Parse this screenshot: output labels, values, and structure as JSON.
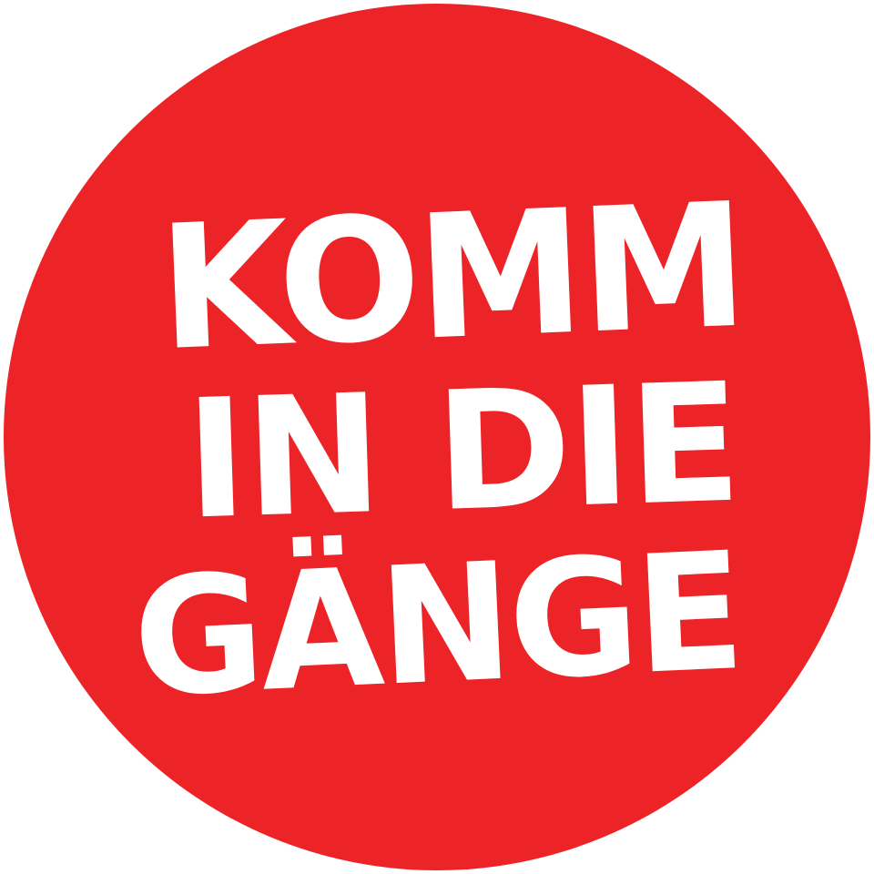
{
  "badge": {
    "background_color": "#ec2427",
    "text_color": "#ffffff",
    "lines": [
      "KOMM",
      "IN DIE",
      "GÄNGE"
    ]
  }
}
